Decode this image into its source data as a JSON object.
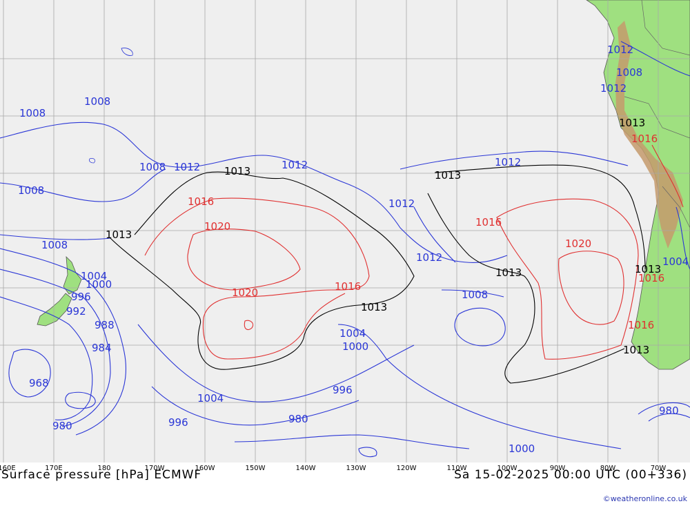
{
  "title_left": "Surface pressure [hPa] ECMWF",
  "title_right": "Sa 15-02-2025 00:00 UTC (00+336)",
  "credit": "©weatheronline.co.uk",
  "lon_labels": [
    {
      "t": "160E",
      "lon": 160
    },
    {
      "t": "170E",
      "lon": 170
    },
    {
      "t": "180",
      "lon": 180
    },
    {
      "t": "170W",
      "lon": 190
    },
    {
      "t": "160W",
      "lon": 200
    },
    {
      "t": "150W",
      "lon": 210
    },
    {
      "t": "140W",
      "lon": 220
    },
    {
      "t": "130W",
      "lon": 230
    },
    {
      "t": "120W",
      "lon": 240
    },
    {
      "t": "110W",
      "lon": 250
    },
    {
      "t": "100W",
      "lon": 260
    },
    {
      "t": "90W",
      "lon": 270
    },
    {
      "t": "80W",
      "lon": 280
    },
    {
      "t": "70W",
      "lon": 290
    }
  ],
  "colors": {
    "sea": "#efefef",
    "land": "#9fe080",
    "grid": "#a8a8a8",
    "isobar_low": "#2a36d6",
    "isobar_mid": "#000000",
    "isobar_high": "#e03030"
  },
  "isobar_labels": [
    {
      "t": "1013",
      "kind": "mid"
    },
    {
      "t": "1013",
      "kind": "mid"
    },
    {
      "t": "1013",
      "kind": "mid"
    },
    {
      "t": "1013",
      "kind": "mid"
    },
    {
      "t": "1013",
      "kind": "mid"
    },
    {
      "t": "1013",
      "kind": "mid"
    },
    {
      "t": "1013",
      "kind": "mid"
    },
    {
      "t": "1013",
      "kind": "mid"
    },
    {
      "t": "1016",
      "kind": "high"
    },
    {
      "t": "1020",
      "kind": "high"
    },
    {
      "t": "1020",
      "kind": "high"
    },
    {
      "t": "1016",
      "kind": "high"
    },
    {
      "t": "1016",
      "kind": "high"
    },
    {
      "t": "1020",
      "kind": "high"
    },
    {
      "t": "1016",
      "kind": "high"
    },
    {
      "t": "1016",
      "kind": "high"
    },
    {
      "t": "1016",
      "kind": "high"
    },
    {
      "t": "1008",
      "kind": "low"
    },
    {
      "t": "1008",
      "kind": "low"
    },
    {
      "t": "1008",
      "kind": "low"
    },
    {
      "t": "1008",
      "kind": "low"
    },
    {
      "t": "1008",
      "kind": "low"
    },
    {
      "t": "1012",
      "kind": "low"
    },
    {
      "t": "1012",
      "kind": "low"
    },
    {
      "t": "1012",
      "kind": "low"
    },
    {
      "t": "1012",
      "kind": "low"
    },
    {
      "t": "1012",
      "kind": "low"
    },
    {
      "t": "1008",
      "kind": "low"
    },
    {
      "t": "1004",
      "kind": "low"
    },
    {
      "t": "1000",
      "kind": "low"
    },
    {
      "t": "996",
      "kind": "low"
    },
    {
      "t": "992",
      "kind": "low"
    },
    {
      "t": "988",
      "kind": "low"
    },
    {
      "t": "984",
      "kind": "low"
    },
    {
      "t": "968",
      "kind": "low"
    },
    {
      "t": "980",
      "kind": "low"
    },
    {
      "t": "1004",
      "kind": "low"
    },
    {
      "t": "996",
      "kind": "low"
    },
    {
      "t": "1004",
      "kind": "low"
    },
    {
      "t": "1000",
      "kind": "low"
    },
    {
      "t": "996",
      "kind": "low"
    },
    {
      "t": "980",
      "kind": "low"
    },
    {
      "t": "1000",
      "kind": "low"
    },
    {
      "t": "980",
      "kind": "low"
    },
    {
      "t": "1008",
      "kind": "low"
    },
    {
      "t": "1012",
      "kind": "low"
    },
    {
      "t": "1012",
      "kind": "low"
    },
    {
      "t": "1004",
      "kind": "low"
    }
  ]
}
